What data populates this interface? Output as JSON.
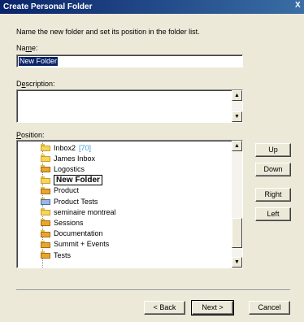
{
  "window": {
    "title": "Create Personal Folder",
    "close_label": "X"
  },
  "intro_text": "Name the new folder and set its position in the folder list.",
  "name": {
    "label_pre": "Na",
    "label_key": "m",
    "label_post": "e:",
    "value": "New Folder"
  },
  "description": {
    "label_pre": "D",
    "label_key": "e",
    "label_post": "scription:",
    "value": ""
  },
  "position": {
    "label_key": "P",
    "label_post": "osition:",
    "items": [
      {
        "label": "Inbox2",
        "count": "[70]",
        "icon": "folder-icon"
      },
      {
        "label": "James Inbox",
        "count": "",
        "icon": "folder-icon"
      },
      {
        "label": "Logostics",
        "count": "",
        "icon": "folder-dark-icon"
      },
      {
        "label": "New Folder",
        "count": "",
        "icon": "folder-icon",
        "selected": true
      },
      {
        "label": "Product",
        "count": "",
        "icon": "folder-dark-icon"
      },
      {
        "label": "Product Tests",
        "count": "",
        "icon": "special-folder-icon"
      },
      {
        "label": "seminaire montreal",
        "count": "",
        "icon": "folder-icon"
      },
      {
        "label": "Sessions",
        "count": "",
        "icon": "folder-dark-icon"
      },
      {
        "label": "Documentation",
        "count": "",
        "icon": "folder-dark-icon"
      },
      {
        "label": "Summit + Events",
        "count": "",
        "icon": "folder-dark-icon"
      },
      {
        "label": "Tests",
        "count": "",
        "icon": "folder-dark-icon"
      }
    ]
  },
  "side_buttons": {
    "up": "Up",
    "down": "Down",
    "right": "Right",
    "left": "Left"
  },
  "footer_buttons": {
    "back": "< Back",
    "next": "Next >",
    "cancel": "Cancel"
  },
  "scroll_glyphs": {
    "up": "▲",
    "down": "▼"
  }
}
